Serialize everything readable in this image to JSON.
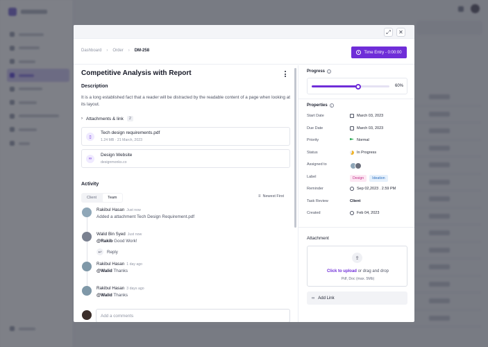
{
  "modal": {
    "breadcrumb": [
      "Dashboard",
      "Order",
      "DM-258"
    ],
    "time_entry_label": "Time Entry - 0:00:00",
    "task_title": "Competitive Analysis with Report",
    "description_title": "Description",
    "description_text": "It is a long established fact that a reader will be distracted by the readable content of a page when looking at its layout.",
    "attachments_label": "Attachments & link",
    "attachments_count": "2",
    "attachments": [
      {
        "name": "Tech design requirements.pdf",
        "meta": "1.24 MB · 21 March, 2023",
        "icon": "file-icon"
      },
      {
        "name": "Design Website",
        "meta": "designmonks.co",
        "icon": "link-icon"
      }
    ],
    "activity_title": "Activity",
    "activity_tabs": [
      "Client",
      "Team"
    ],
    "activity_active_tab": "Team",
    "sort_label": "Newest First",
    "activity": [
      {
        "name": "Rakibul Hasan",
        "time": "Just now",
        "text_prefix": "Added a attachment",
        "text_rest": "Tech Design Requirement.pdf"
      },
      {
        "name": "Walid Bin Syed",
        "time": "Just now",
        "mention": "@Rakib",
        "text": "Good Work!"
      },
      {
        "name": "Rakibul Hasan",
        "time": "1 day ago",
        "mention": "@Walid",
        "text": "Thanks"
      },
      {
        "name": "Rakibul Hasan",
        "time": "3 days ago",
        "mention": "@Walid",
        "text": "Thanks"
      }
    ],
    "reply_label": "Reply",
    "comment_placeholder": "Add a comments"
  },
  "sidebar": {
    "progress_title": "Progress",
    "progress_value": 60,
    "progress_label": "60%",
    "properties_title": "Properties",
    "properties": {
      "start_date": {
        "label": "Start Date",
        "value": "March 03, 2023"
      },
      "due_date": {
        "label": "Due Date",
        "value": "March 03, 2023"
      },
      "priority": {
        "label": "Priority",
        "value": "Normal"
      },
      "status": {
        "label": "Status",
        "value": "In Progress"
      },
      "assigned_to": {
        "label": "Assigned to"
      },
      "label": {
        "label": "Label",
        "tags": [
          "Design",
          "Ideation"
        ]
      },
      "reminder": {
        "label": "Reminder",
        "value": "Sep 02,2023 . 2.59 PM"
      },
      "task_review": {
        "label": "Task Review",
        "value": "Client"
      },
      "created": {
        "label": "Created",
        "value": "Feb 04, 2023"
      }
    },
    "attachment_title": "Attachment",
    "upload_link": "Click to upload",
    "upload_rest": "or drag and drop",
    "upload_hint": "Pdf, Doc  (max. 5Mb)",
    "add_link_label": "Add Link"
  },
  "colors": {
    "accent": "#6f2dd8",
    "priority_flag": "#1ea64b",
    "status": "#f0b429"
  }
}
